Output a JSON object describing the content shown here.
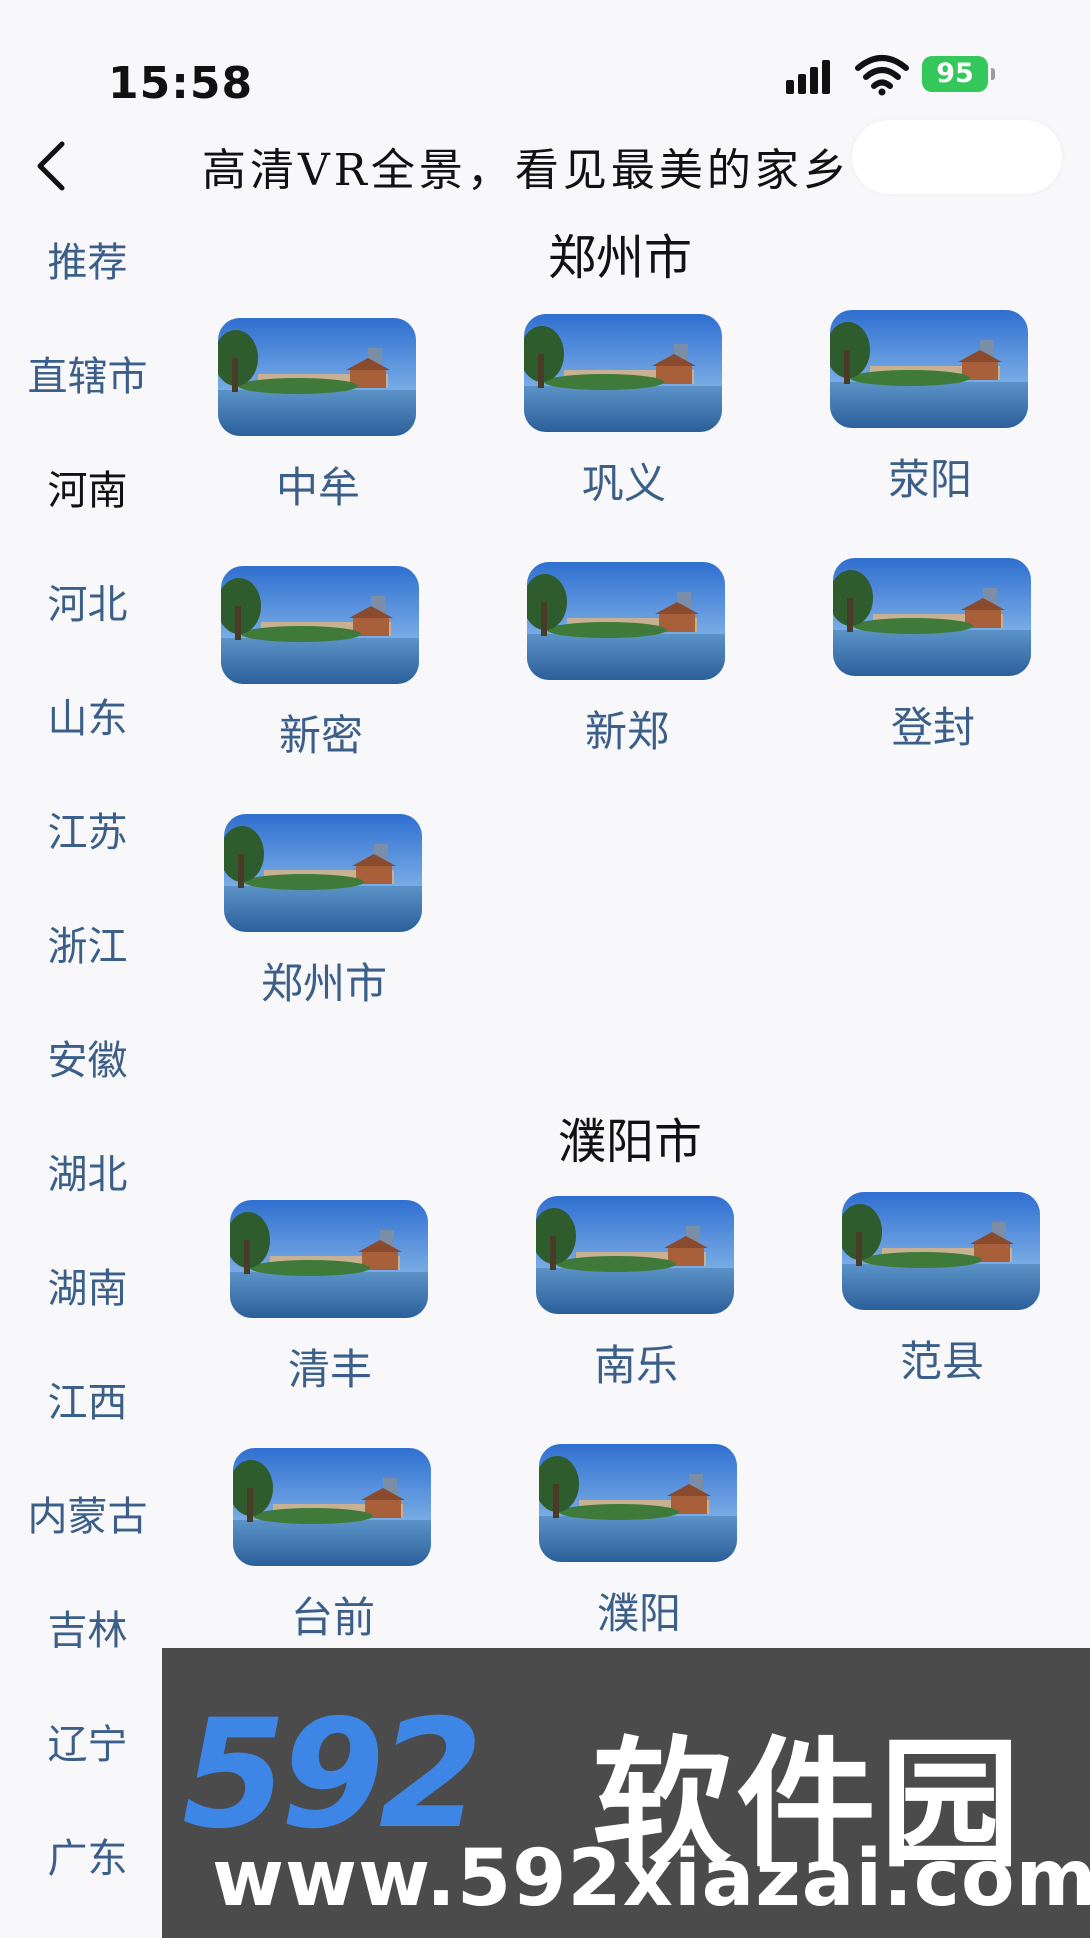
{
  "status": {
    "time": "15:58",
    "battery": "95"
  },
  "nav": {
    "title": "高清VR全景，看见最美的家乡"
  },
  "sidebar": {
    "items": [
      {
        "label": "推荐"
      },
      {
        "label": "直辖市"
      },
      {
        "label": "河南",
        "active": true
      },
      {
        "label": "河北"
      },
      {
        "label": "山东"
      },
      {
        "label": "江苏"
      },
      {
        "label": "浙江"
      },
      {
        "label": "安徽"
      },
      {
        "label": "湖北"
      },
      {
        "label": "湖南"
      },
      {
        "label": "江西"
      },
      {
        "label": "内蒙古"
      },
      {
        "label": "吉林"
      },
      {
        "label": "辽宁"
      },
      {
        "label": "广东"
      }
    ]
  },
  "sections": [
    {
      "title": "郑州市",
      "items": [
        "中牟",
        "巩义",
        "荥阳",
        "新密",
        "新郑",
        "登封",
        "郑州市"
      ]
    },
    {
      "title": "濮阳市",
      "items": [
        "清丰",
        "南乐",
        "范县",
        "台前",
        "濮阳"
      ]
    }
  ],
  "watermark": {
    "brand_num": "592",
    "brand_cn": "软件园",
    "url": "www.592xiazai.com"
  },
  "colors": {
    "label": "#3b5f88",
    "battery": "#34c759",
    "wm_blue": "#3d86e6"
  }
}
